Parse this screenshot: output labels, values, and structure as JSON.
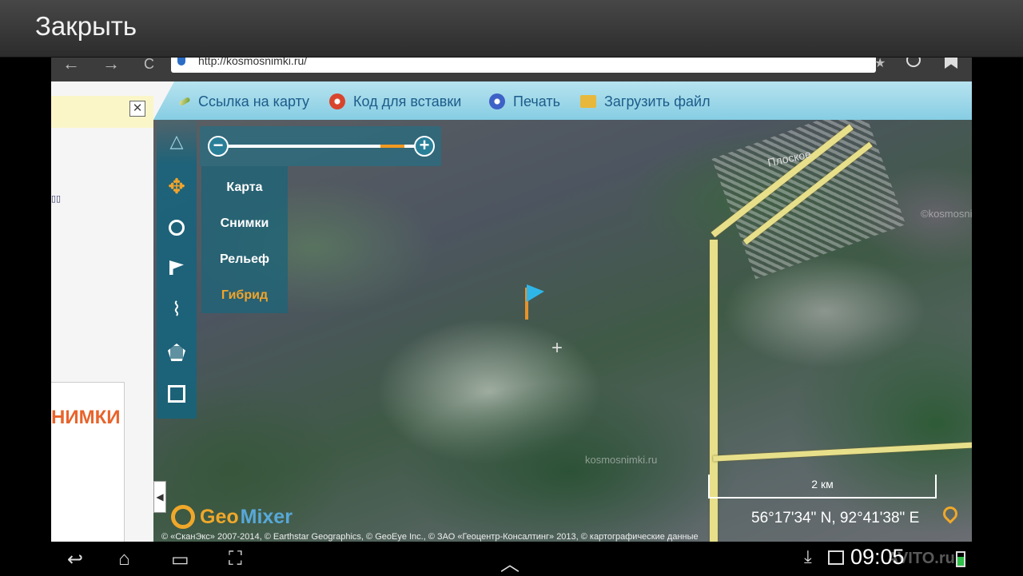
{
  "header": {
    "close_label": "Закрыть"
  },
  "browser": {
    "url": "http://kosmosnimki.ru/",
    "back_glyph": "←",
    "forward_glyph": "→",
    "reload_glyph": "C",
    "star_glyph": "★"
  },
  "left_panel": {
    "close_glyph": "✕",
    "banner_text": "НИМКИ"
  },
  "toolbar": {
    "items": [
      {
        "label": "Ссылка на карту",
        "icon": "link-icon"
      },
      {
        "label": "Код для вставки",
        "icon": "gear-icon"
      },
      {
        "label": "Печать",
        "icon": "print-icon"
      },
      {
        "label": "Загрузить файл",
        "icon": "folder-icon"
      }
    ]
  },
  "zoom": {
    "minus": "−",
    "plus": "+",
    "level_fraction": 0.9
  },
  "layers": {
    "items": [
      "Карта",
      "Снимки",
      "Рельеф",
      "Гибрид"
    ],
    "active": "Гибрид",
    "active_color": "#f3a42a"
  },
  "map": {
    "place_label": "Плоское",
    "watermarks": [
      "©kosmosnimki.ru",
      "©kosmosnimki.ru",
      "kosmosnimki.ru"
    ],
    "scale_label": "2 км",
    "coordinates": "56°17'34\" N, 92°41'38\" E",
    "copyright": "© «СканЭкс» 2007-2014, © Earthstar Geographics, © GeoEye Inc., © ЗАО «Геоцентр-Консалтинг» 2013, © картографические данные",
    "logo_geo": "Geo",
    "logo_mixer": "Mixer"
  },
  "system_bar": {
    "time": "09:05",
    "watermark": "AVITO.ru",
    "back_glyph": "↩",
    "home_glyph": "⌂",
    "recents_glyph": "▭",
    "screenshot_glyph": "⛶",
    "up_glyph": "︿",
    "download_glyph": "⤓"
  },
  "colors": {
    "toolbar_bg": "#86cde3",
    "toolbar_text": "#1d5c8a",
    "accent_orange": "#f3a42a",
    "banner_orange": "#e8642c"
  }
}
